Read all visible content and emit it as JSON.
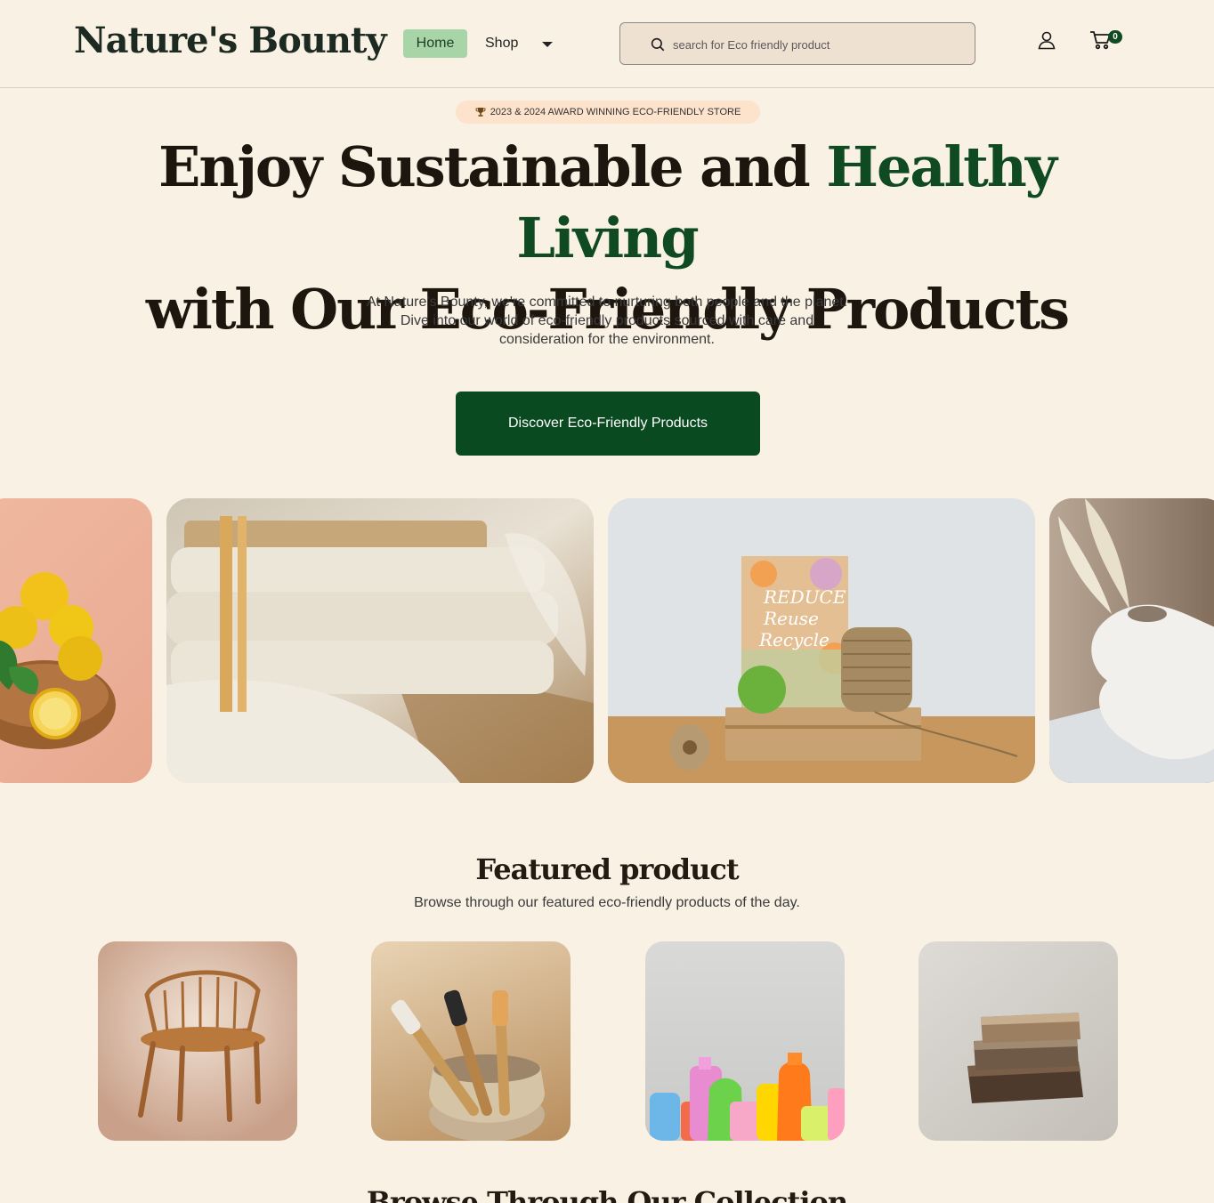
{
  "header": {
    "logo": "Nature's Bounty",
    "nav": {
      "home": "Home",
      "shop": "Shop"
    },
    "search": {
      "placeholder": "search for Eco friendly product"
    },
    "cart_count": "0"
  },
  "hero": {
    "award_badge": "2023 & 2024 AWARD WINNING ECO-FRIENDLY STORE",
    "title_part1": "Enjoy Sustainable and ",
    "title_accent": "Healthy Living",
    "title_part2": "with Our Eco-Friendly Products",
    "subtitle": "At Nature's Bounty, we're committed to nurturing both people and the planet. Dive into our world of eco-friendly products sourced with care and consideration for the environment.",
    "cta_label": "Discover Eco-Friendly Products"
  },
  "gallery": {
    "tiles": [
      "lemons",
      "cotton-cloths",
      "reduce-reuse-recycle",
      "white-vase"
    ],
    "sign_text": [
      "REDUCE",
      "Reuse",
      "Recycle"
    ]
  },
  "featured": {
    "title": "Featured product",
    "subtitle": "Browse through our featured eco-friendly products of the day.",
    "products": [
      "rattan-chair",
      "bamboo-toothbrushes",
      "cleaning-bottles",
      "natural-soap"
    ]
  },
  "next_section": {
    "title": "Browse Through Our Collection"
  },
  "colors": {
    "background": "#f9f1e4",
    "accent_green": "#0f4a22",
    "nav_active": "#a8d5a8",
    "badge_bg": "#fde2cc"
  },
  "icons": [
    "search-icon",
    "user-icon",
    "cart-icon",
    "trophy-icon",
    "chevron-down-icon"
  ]
}
